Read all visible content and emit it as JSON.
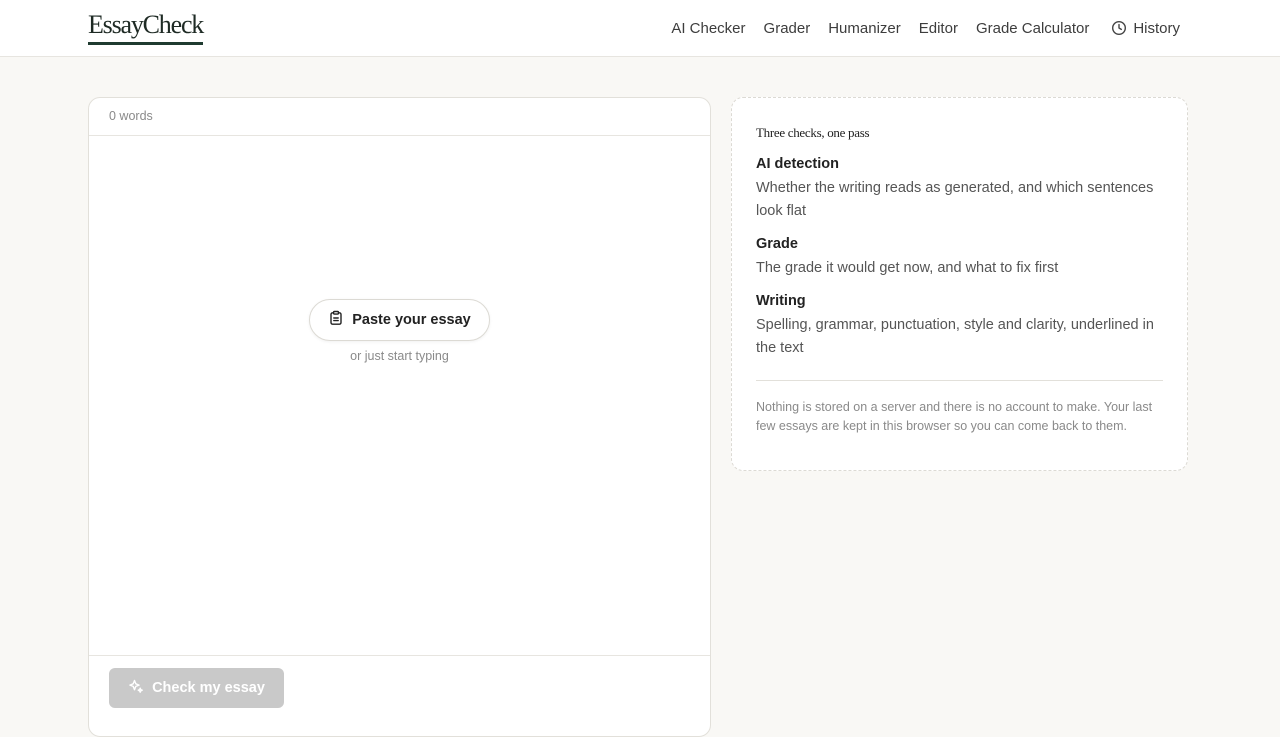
{
  "header": {
    "logo": "EssayCheck",
    "nav": [
      {
        "label": "AI Checker"
      },
      {
        "label": "Grader"
      },
      {
        "label": "Humanizer"
      },
      {
        "label": "Editor"
      },
      {
        "label": "Grade Calculator"
      }
    ],
    "history_label": "History",
    "history_icon": "clock-icon"
  },
  "editor": {
    "word_count": "0 words",
    "paste_button": "Paste your essay",
    "paste_icon": "clipboard-icon",
    "paste_hint": "or just start typing",
    "check_button": "Check my essay",
    "check_icon": "sparkle-icon"
  },
  "info": {
    "title": "Three checks, one pass",
    "features": [
      {
        "title": "AI detection",
        "desc": "Whether the writing reads as generated, and which sentences look flat"
      },
      {
        "title": "Grade",
        "desc": "The grade it would get now, and what to fix first"
      },
      {
        "title": "Writing",
        "desc": "Spelling, grammar, punctuation, style and clarity, underlined in the text"
      }
    ],
    "note": "Nothing is stored on a server and there is no account to make. Your last few essays are kept in this browser so you can come back to them."
  },
  "colors": {
    "background": "#f9f8f5",
    "logo_underline": "#1f3b30",
    "check_button_disabled": "#c9c9c9"
  }
}
